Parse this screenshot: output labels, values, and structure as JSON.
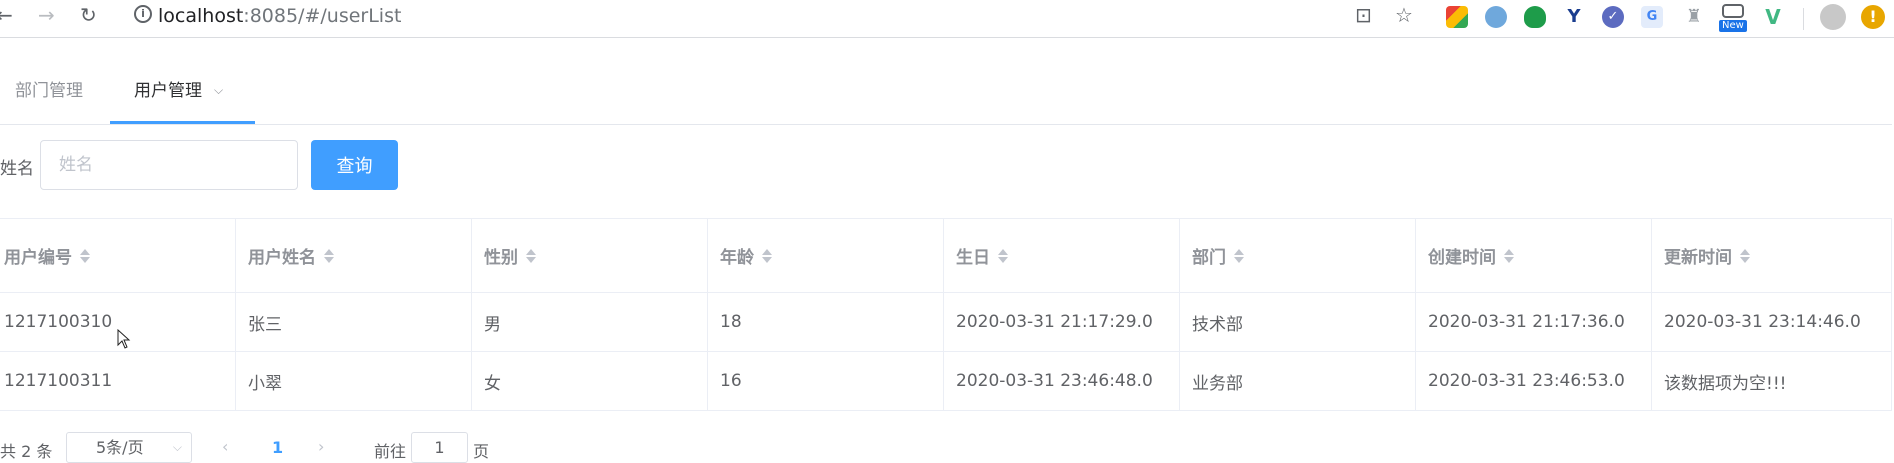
{
  "browser": {
    "url_host": "localhost",
    "url_path": ":8085/#/userList",
    "info_glyph": "i",
    "new_badge": "New",
    "alert_glyph": "!"
  },
  "tabs": [
    {
      "label": "部门管理",
      "active": false
    },
    {
      "label": "用户管理",
      "active": true
    }
  ],
  "search": {
    "label": "姓名",
    "placeholder": "姓名",
    "value": "",
    "button": "查询"
  },
  "table": {
    "columns": [
      "用户编号",
      "用户姓名",
      "性别",
      "年龄",
      "生日",
      "部门",
      "创建时间",
      "更新时间"
    ],
    "rows": [
      [
        "1217100310",
        "张三",
        "男",
        "18",
        "2020-03-31 21:17:29.0",
        "技术部",
        "2020-03-31 21:17:36.0",
        "2020-03-31 23:14:46.0"
      ],
      [
        "1217100311",
        "小翠",
        "女",
        "16",
        "2020-03-31 23:46:48.0",
        "业务部",
        "2020-03-31 23:46:53.0",
        "该数据项为空!!!"
      ]
    ]
  },
  "pagination": {
    "total_text": "共 2 条",
    "page_size": "5条/页",
    "current_page": "1",
    "goto_label": "前往",
    "goto_value": "1",
    "goto_unit": "页"
  },
  "colors": {
    "primary": "#409eff",
    "border": "#ebeef5",
    "text": "#606266",
    "muted": "#909399"
  }
}
